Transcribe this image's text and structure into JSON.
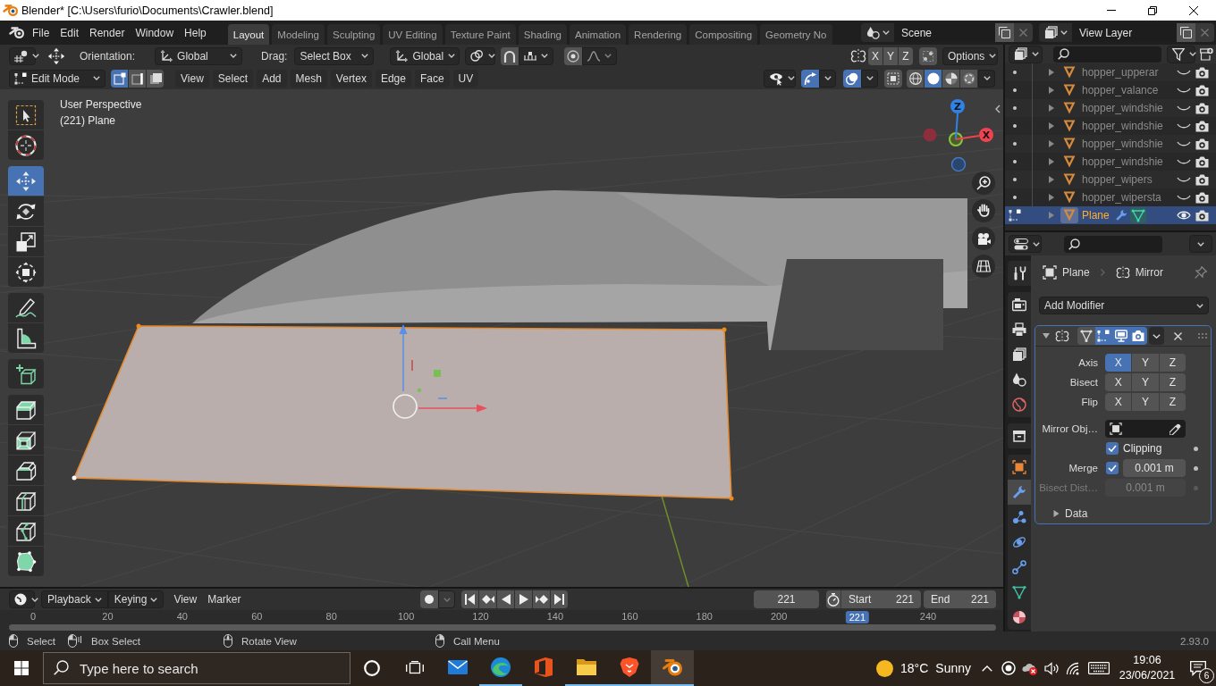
{
  "window": {
    "title": "Blender* [C:\\Users\\furio\\Documents\\Crawler.blend]"
  },
  "topbar": {
    "menus": [
      "File",
      "Edit",
      "Render",
      "Window",
      "Help"
    ],
    "workspaces": [
      {
        "label": "Layout",
        "selected": true
      },
      {
        "label": "Modeling",
        "selected": false
      },
      {
        "label": "Sculpting",
        "selected": false
      },
      {
        "label": "UV Editing",
        "selected": false
      },
      {
        "label": "Texture Paint",
        "selected": false
      },
      {
        "label": "Shading",
        "selected": false
      },
      {
        "label": "Animation",
        "selected": false
      },
      {
        "label": "Rendering",
        "selected": false
      },
      {
        "label": "Compositing",
        "selected": false
      },
      {
        "label": "Geometry No",
        "selected": false
      }
    ],
    "scene": "Scene",
    "view_layer": "View Layer"
  },
  "tool_header": {
    "orientation_label": "Orientation:",
    "orientation": "Global",
    "drag_label": "Drag:",
    "drag": "Select Box",
    "transform_orientation": "Global",
    "snap": false,
    "proportional_editing": false,
    "mirror_axes": [
      {
        "label": "X",
        "selected": false
      },
      {
        "label": "Y",
        "selected": false
      },
      {
        "label": "Z",
        "selected": false
      }
    ],
    "auto_merge": false,
    "options": "Options"
  },
  "viewport_header": {
    "mode": "Edit Mode",
    "select_modes": [
      {
        "kind": "vertex",
        "selected": true
      },
      {
        "kind": "edge",
        "selected": false
      },
      {
        "kind": "face",
        "selected": false
      }
    ],
    "menus": [
      "View",
      "Select",
      "Add",
      "Mesh",
      "Vertex",
      "Edge",
      "Face",
      "UV"
    ],
    "gizmos": true,
    "overlays": true,
    "xray": false,
    "shading": [
      {
        "kind": "wireframe",
        "selected": false
      },
      {
        "kind": "solid",
        "selected": true
      },
      {
        "kind": "material",
        "selected": false
      },
      {
        "kind": "rendered",
        "selected": false
      }
    ]
  },
  "viewport": {
    "view_name": "User Perspective",
    "object_info": "(221) Plane",
    "toolbar": [
      {
        "tools": [
          {
            "kind": "select_box",
            "selected": false
          },
          {
            "kind": "cursor",
            "selected": false
          }
        ]
      },
      {
        "tools": [
          {
            "kind": "move",
            "selected": true
          },
          {
            "kind": "rotate",
            "selected": false
          },
          {
            "kind": "scale",
            "selected": false
          },
          {
            "kind": "transform",
            "selected": false
          }
        ]
      },
      {
        "tools": [
          {
            "kind": "annotate",
            "selected": false
          },
          {
            "kind": "measure",
            "selected": false
          }
        ]
      },
      {
        "tools": [
          {
            "kind": "add_cube",
            "selected": false
          }
        ]
      },
      {
        "tools": [
          {
            "kind": "extrude",
            "selected": false
          },
          {
            "kind": "inset",
            "selected": false
          },
          {
            "kind": "bevel",
            "selected": false
          },
          {
            "kind": "loop_cut",
            "selected": false
          },
          {
            "kind": "knife",
            "selected": false
          },
          {
            "kind": "poly_build",
            "selected": false
          }
        ]
      }
    ],
    "axes": [
      {
        "label": "Z",
        "color": "#2f83e6"
      },
      {
        "label": "X",
        "color": "#f0424f"
      }
    ]
  },
  "outliner": {
    "rows": [
      {
        "name": "hopper_upperar",
        "selected": false,
        "visible": false,
        "edit_mode": false,
        "modifiers": false
      },
      {
        "name": "hopper_valance",
        "selected": false,
        "visible": false,
        "edit_mode": false,
        "modifiers": false
      },
      {
        "name": "hopper_windshie",
        "selected": false,
        "visible": false,
        "edit_mode": false,
        "modifiers": false
      },
      {
        "name": "hopper_windshie",
        "selected": false,
        "visible": false,
        "edit_mode": false,
        "modifiers": false
      },
      {
        "name": "hopper_windshie",
        "selected": false,
        "visible": false,
        "edit_mode": false,
        "modifiers": false
      },
      {
        "name": "hopper_windshie",
        "selected": false,
        "visible": false,
        "edit_mode": false,
        "modifiers": false
      },
      {
        "name": "hopper_wipers",
        "selected": false,
        "visible": false,
        "edit_mode": false,
        "modifiers": false
      },
      {
        "name": "hopper_wipersta",
        "selected": false,
        "visible": false,
        "edit_mode": false,
        "modifiers": false
      },
      {
        "name": "Plane",
        "selected": true,
        "visible": true,
        "edit_mode": true,
        "modifiers": true
      }
    ]
  },
  "properties": {
    "tab_groups": [
      {
        "tabs": [
          {
            "kind": "tool",
            "selected": false
          }
        ]
      },
      {
        "tabs": [
          {
            "kind": "render",
            "selected": false
          },
          {
            "kind": "output",
            "selected": false
          },
          {
            "kind": "view_layer",
            "selected": false
          },
          {
            "kind": "scene",
            "selected": false
          },
          {
            "kind": "world",
            "selected": false
          }
        ]
      },
      {
        "tabs": [
          {
            "kind": "collection",
            "selected": false
          }
        ]
      },
      {
        "tabs": [
          {
            "kind": "object",
            "selected": false
          },
          {
            "kind": "modifiers",
            "selected": true
          },
          {
            "kind": "particles",
            "selected": false
          },
          {
            "kind": "physics",
            "selected": false
          },
          {
            "kind": "constraints",
            "selected": false
          },
          {
            "kind": "data",
            "selected": false
          },
          {
            "kind": "material",
            "selected": false
          }
        ]
      }
    ],
    "breadcrumb": [
      {
        "kind": "object",
        "label": "Plane"
      },
      {
        "kind": "modifier",
        "label": "Mirror"
      }
    ],
    "add_modifier": "Add Modifier",
    "modifier": {
      "expanded": true,
      "toggles": [
        {
          "kind": "on_cage",
          "on": false
        },
        {
          "kind": "edit_mode",
          "on": true
        },
        {
          "kind": "viewport",
          "on": true
        },
        {
          "kind": "render",
          "on": true
        }
      ],
      "axis_rows": [
        {
          "label": "Axis",
          "buttons": [
            {
              "label": "X",
              "selected": true
            },
            {
              "label": "Y",
              "selected": false
            },
            {
              "label": "Z",
              "selected": false
            }
          ]
        },
        {
          "label": "Bisect",
          "buttons": [
            {
              "label": "X",
              "selected": false
            },
            {
              "label": "Y",
              "selected": false
            },
            {
              "label": "Z",
              "selected": false
            }
          ]
        },
        {
          "label": "Flip",
          "buttons": [
            {
              "label": "X",
              "selected": false
            },
            {
              "label": "Y",
              "selected": false
            },
            {
              "label": "Z",
              "selected": false
            }
          ]
        }
      ],
      "mirror_object": {
        "label": "Mirror Obj…"
      },
      "clipping": {
        "label": "Clipping",
        "checked": true
      },
      "merge": {
        "label": "Merge",
        "checked": true,
        "value": "0.001 m"
      },
      "bisect_distance": {
        "label": "Bisect Dist…",
        "value": "0.001 m",
        "disabled": true
      },
      "subpanels": [
        {
          "label": "Data",
          "expanded": false
        }
      ]
    }
  },
  "timeline": {
    "menus": [
      {
        "label": "Playback",
        "dropdown": true
      },
      {
        "label": "Keying",
        "dropdown": true
      },
      {
        "label": "View",
        "dropdown": false
      },
      {
        "label": "Marker",
        "dropdown": false
      }
    ],
    "auto_keying": false,
    "current_frame": "221",
    "start": {
      "label": "Start",
      "value": "221"
    },
    "end": {
      "label": "End",
      "value": "221"
    },
    "frames_before_playhead": [
      "0",
      "20",
      "40",
      "60",
      "80",
      "100",
      "120",
      "140",
      "160",
      "180",
      "200"
    ],
    "playhead": {
      "label": "221",
      "level": 0.921
    },
    "frames_after_playhead": [
      "240"
    ]
  },
  "status_bar": {
    "hints": [
      {
        "kind": "left_click",
        "label": "Select"
      },
      {
        "kind": "left_drag",
        "label": "Box Select"
      },
      {
        "kind": "middle_click",
        "label": "Rotate View"
      },
      {
        "kind": "right_click",
        "label": "Call Menu"
      }
    ],
    "version": "2.93.0"
  },
  "taskbar": {
    "search": {
      "placeholder": "Type here to search"
    },
    "apps": [
      {
        "kind": "mail",
        "running": false,
        "selected": false
      },
      {
        "kind": "edge",
        "running": true,
        "selected": false
      },
      {
        "kind": "office",
        "running": false,
        "selected": false
      },
      {
        "kind": "explorer",
        "running": true,
        "selected": false
      },
      {
        "kind": "brave",
        "running": true,
        "selected": false
      },
      {
        "kind": "blender",
        "running": true,
        "selected": true
      }
    ],
    "weather": {
      "temperature": "18°C",
      "condition": "Sunny"
    },
    "time": "19:06",
    "date": "23/06/2021",
    "notifications": "6"
  }
}
